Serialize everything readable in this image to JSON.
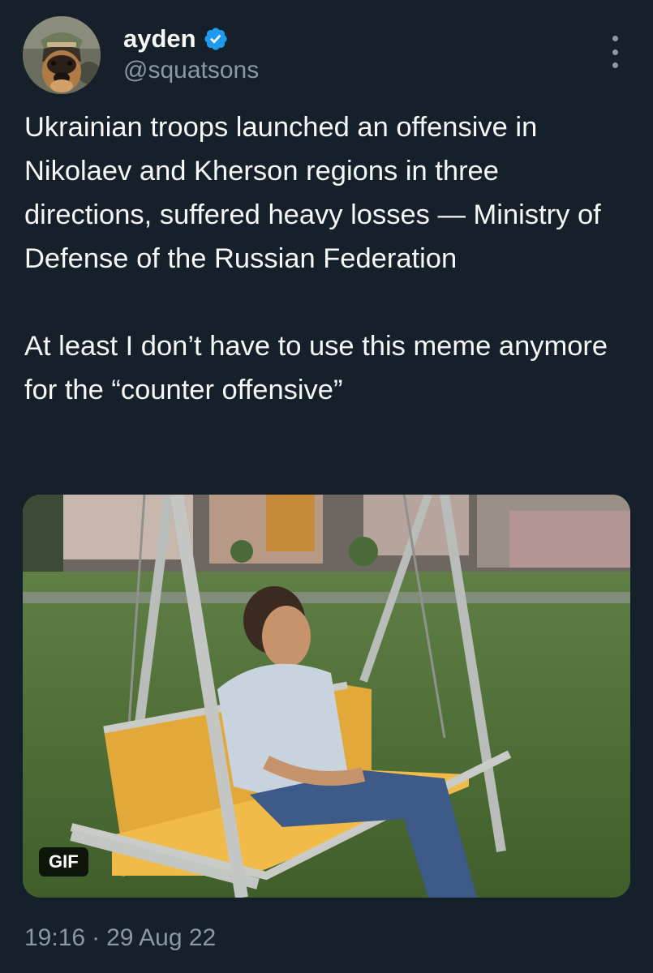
{
  "author": {
    "display_name": "ayden",
    "handle": "@squatsons",
    "verified": true,
    "verified_color": "#1d9bf0",
    "avatar_icon": "dog-with-helmet-avatar"
  },
  "tweet": {
    "paragraphs": [
      "Ukrainian troops launched an offensive in Nikolaev and Kherson regions in three directions, suffered heavy losses — Ministry of Defense of the Russian Federation",
      "At least I don’t have to use this meme anymore for the “counter offensive”"
    ],
    "media": {
      "type": "gif",
      "badge": "GIF"
    }
  },
  "meta": {
    "time": "19:16",
    "separator": "·",
    "date": "29 Aug 22"
  },
  "colors": {
    "background": "#15202b",
    "text": "#f7f9f9",
    "secondary_text": "#8b98a5"
  }
}
